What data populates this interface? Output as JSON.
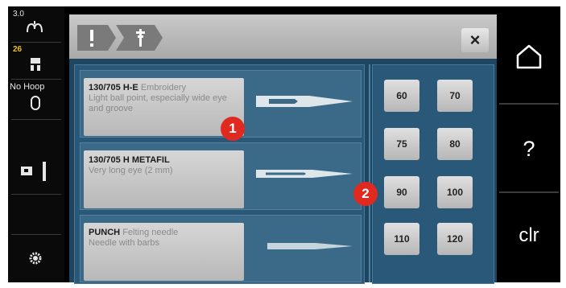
{
  "status": {
    "stitch_width": "3.0",
    "stitch_number": "26",
    "hoop_label": "No Hoop"
  },
  "window": {
    "breadcrumb_icons": [
      "exclamation-icon",
      "needle-icon"
    ],
    "close_label": "×"
  },
  "needles": [
    {
      "title": "130/705 H-E",
      "subtitle": "Embroidery",
      "description": "Light ball point, especially wide eye and groove"
    },
    {
      "title": "130/705 H METAFIL",
      "subtitle": "",
      "description": "Very long eye (2 mm)"
    },
    {
      "title": "PUNCH",
      "subtitle": "Felting needle",
      "description": "Needle with barbs"
    }
  ],
  "sizes": [
    "60",
    "70",
    "75",
    "80",
    "90",
    "100",
    "110",
    "120"
  ],
  "right_buttons": {
    "help_label": "?",
    "clr_label": "clr"
  },
  "callouts": [
    "1",
    "2"
  ],
  "colors": {
    "screen_bg": "#1e4660",
    "panel_bg": "#2a5878",
    "callout": "#e02a20",
    "stitch_number_color": "#e8c21a"
  }
}
